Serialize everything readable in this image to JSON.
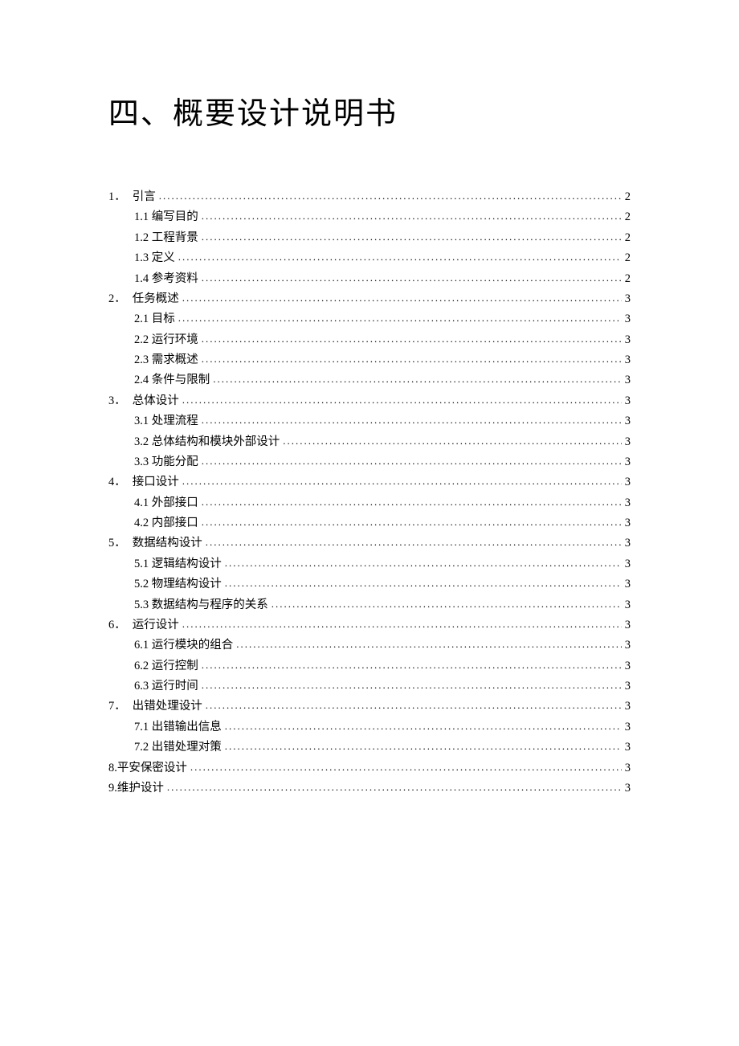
{
  "title": "四、概要设计说明书",
  "toc": [
    {
      "level": 0,
      "numbered": true,
      "num": "1．",
      "text": "引言",
      "page": "2"
    },
    {
      "level": 1,
      "text": "1.1 编写目的",
      "page": "2"
    },
    {
      "level": 1,
      "text": "1.2 工程背景",
      "page": "2"
    },
    {
      "level": 1,
      "text": "1.3 定义",
      "page": "2"
    },
    {
      "level": 1,
      "text": "1.4 参考资料",
      "page": "2"
    },
    {
      "level": 0,
      "numbered": true,
      "num": "2．",
      "text": "任务概述",
      "page": "3"
    },
    {
      "level": 1,
      "text": "2.1 目标",
      "page": "3"
    },
    {
      "level": 1,
      "text": "2.2 运行环境",
      "page": "3"
    },
    {
      "level": 1,
      "text": "2.3 需求概述",
      "page": "3"
    },
    {
      "level": 1,
      "text": "2.4 条件与限制",
      "page": "3"
    },
    {
      "level": 0,
      "numbered": true,
      "num": "3．",
      "text": "总体设计",
      "page": "3"
    },
    {
      "level": 1,
      "text": "3.1 处理流程",
      "page": "3"
    },
    {
      "level": 1,
      "text": "3.2 总体结构和模块外部设计",
      "page": "3"
    },
    {
      "level": 1,
      "text": "3.3 功能分配",
      "page": "3"
    },
    {
      "level": 0,
      "numbered": true,
      "num": "4．",
      "text": "接口设计",
      "page": "3"
    },
    {
      "level": 1,
      "text": "4.1 外部接口",
      "page": "3"
    },
    {
      "level": 1,
      "text": "4.2 内部接口",
      "page": "3"
    },
    {
      "level": 0,
      "numbered": true,
      "num": "5．",
      "text": "数据结构设计",
      "page": "3"
    },
    {
      "level": 1,
      "text": "5.1 逻辑结构设计",
      "page": "3"
    },
    {
      "level": 1,
      "text": "5.2 物理结构设计",
      "page": "3"
    },
    {
      "level": 1,
      "text": "5.3 数据结构与程序的关系",
      "page": "3"
    },
    {
      "level": 0,
      "numbered": true,
      "num": "6．",
      "text": "运行设计",
      "page": "3"
    },
    {
      "level": 1,
      "text": "6.1 运行模块的组合",
      "page": "3"
    },
    {
      "level": 1,
      "text": "6.2 运行控制",
      "page": "3"
    },
    {
      "level": 1,
      "text": "6.3 运行时间",
      "page": "3"
    },
    {
      "level": 0,
      "numbered": true,
      "num": "7．",
      "text": "出错处理设计",
      "page": "3"
    },
    {
      "level": 1,
      "text": "7.1 出错输出信息",
      "page": "3"
    },
    {
      "level": 1,
      "text": "7.2 出错处理对策",
      "page": "3"
    },
    {
      "level": 0,
      "numbered": false,
      "text": "8.平安保密设计",
      "page": "3"
    },
    {
      "level": 0,
      "numbered": false,
      "text": "9.维护设计",
      "page": "3"
    }
  ]
}
